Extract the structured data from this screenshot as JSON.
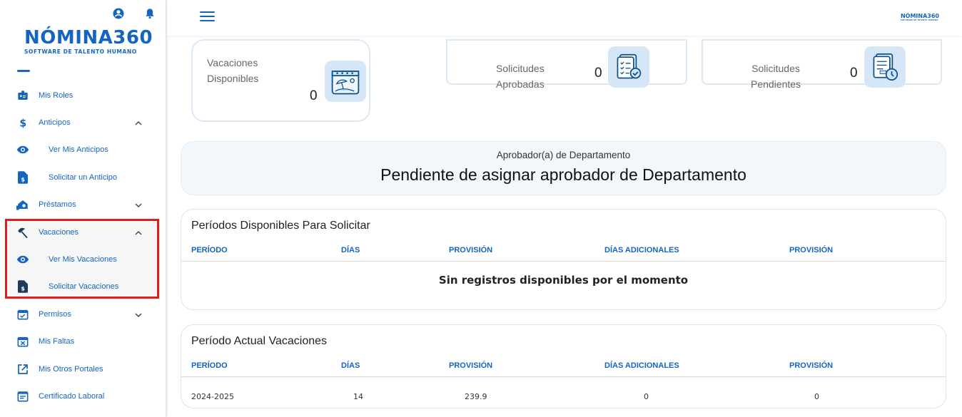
{
  "logo": {
    "main": "NÓMINA360",
    "sub": "SOFTWARE DE TALENTO HUMANO"
  },
  "topbar": {
    "mini_logo": "NÓMINA360",
    "mini_logo_sub": "SOFTWARE DE TALENTO HUMANO"
  },
  "sidebar": {
    "items": [
      {
        "label": "Mis Roles",
        "icon": "badge-icon"
      },
      {
        "label": "Anticipos",
        "icon": "dollar-icon",
        "chevron": "up"
      },
      {
        "label": "Ver Mis Anticipos",
        "icon": "eye-icon"
      },
      {
        "label": "Solicitar un Anticipo",
        "icon": "request-doc-icon"
      },
      {
        "label": "Préstamos",
        "icon": "loan-icon",
        "chevron": "down"
      },
      {
        "label": "Vacaciones",
        "icon": "beach-umbrella-icon",
        "chevron": "up"
      },
      {
        "label": "Ver Mis Vacaciones",
        "icon": "eye-icon"
      },
      {
        "label": "Solicitar Vacaciones",
        "icon": "request-doc-icon"
      },
      {
        "label": "Permisos",
        "icon": "calendar-check-icon",
        "chevron": "down"
      },
      {
        "label": "Mis Faltas",
        "icon": "calendar-x-icon"
      },
      {
        "label": "Mis Otros Portales",
        "icon": "external-link-icon"
      },
      {
        "label": "Certificado Laboral",
        "icon": "certificate-icon"
      }
    ]
  },
  "stats": {
    "vacaciones": {
      "label_line1": "Vacaciones",
      "label_line2": "Disponibles",
      "value": "0"
    },
    "aprobadas": {
      "label_line1": "Solicitudes",
      "label_line2": "Aprobadas",
      "value": "0"
    },
    "pendientes": {
      "label_line1": "Solicitudes",
      "label_line2": "Pendientes",
      "value": "0"
    }
  },
  "approver": {
    "label": "Aprobador(a) de Departamento",
    "value": "Pendiente de asignar aprobador de Departamento"
  },
  "periodos_disponibles": {
    "title": "Períodos Disponibles Para Solicitar",
    "headers": [
      "PERÍODO",
      "DÍAS",
      "PROVISIÓN",
      "DÍAS ADICIONALES",
      "PROVISIÓN"
    ],
    "empty_text": "Sin registros disponibles por el momento"
  },
  "periodo_actual": {
    "title": "Período Actual Vacaciones",
    "headers": [
      "PERÍODO",
      "DÍAS",
      "PROVISIÓN",
      "DÍAS ADICIONALES",
      "PROVISIÓN"
    ],
    "rows": [
      [
        "2024-2025",
        "14",
        "239.9",
        "0",
        "0"
      ]
    ]
  },
  "colors": {
    "brand": "#1565c0",
    "highlight": "#e21b1b",
    "card_border": "#dbe9f6",
    "icon_bg": "#d5e7f7"
  }
}
